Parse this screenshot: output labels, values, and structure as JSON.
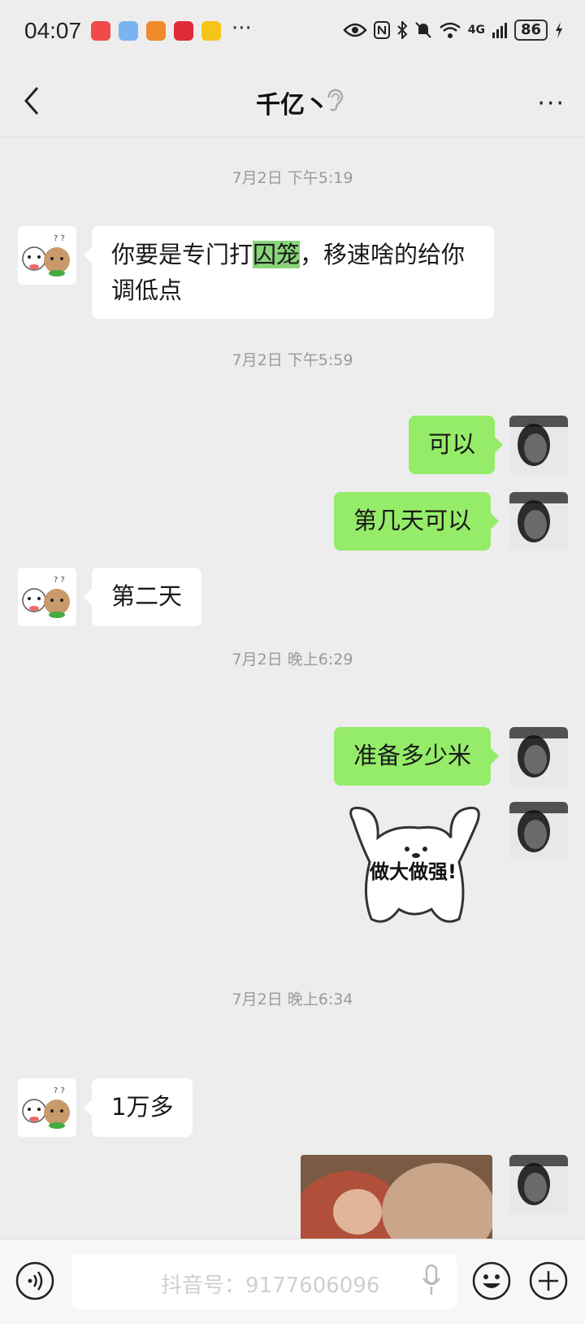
{
  "status_bar": {
    "time": "04:07",
    "network": "4G",
    "battery": "86"
  },
  "header": {
    "title": "千亿丶"
  },
  "messages": [
    {
      "type": "timestamp",
      "text": "7月2日 下午5:19"
    },
    {
      "type": "text",
      "side": "in",
      "pre": "你要是专门打",
      "highlight": "囚笼",
      "post": "，移速啥的给你",
      "line2": "调低点"
    },
    {
      "type": "timestamp",
      "text": "7月2日 下午5:59"
    },
    {
      "type": "text",
      "side": "out",
      "text": "可以"
    },
    {
      "type": "text",
      "side": "out",
      "text": "第几天可以"
    },
    {
      "type": "text",
      "side": "in",
      "text": "第二天"
    },
    {
      "type": "timestamp",
      "text": "7月2日 晚上6:29"
    },
    {
      "type": "text",
      "side": "out",
      "text": "准备多少米"
    },
    {
      "type": "sticker",
      "side": "out",
      "caption": "做大做强!"
    },
    {
      "type": "timestamp",
      "text": "7月2日 晚上6:34"
    },
    {
      "type": "text",
      "side": "in",
      "text": "1万多"
    },
    {
      "type": "image",
      "side": "out"
    }
  ],
  "input_bar": {
    "watermark": "抖音号：9177606096"
  },
  "icons": {
    "back": "back-arrow-icon",
    "ear": "ear-icon",
    "menu": "more-icon",
    "voice": "voice-icon",
    "emoji": "emoji-icon",
    "plus": "plus-icon",
    "mic": "mic-icon"
  },
  "colors": {
    "background": "#ededed",
    "out_bubble": "#95ec69",
    "in_bubble": "#ffffff",
    "highlight": "#8ad57a"
  }
}
